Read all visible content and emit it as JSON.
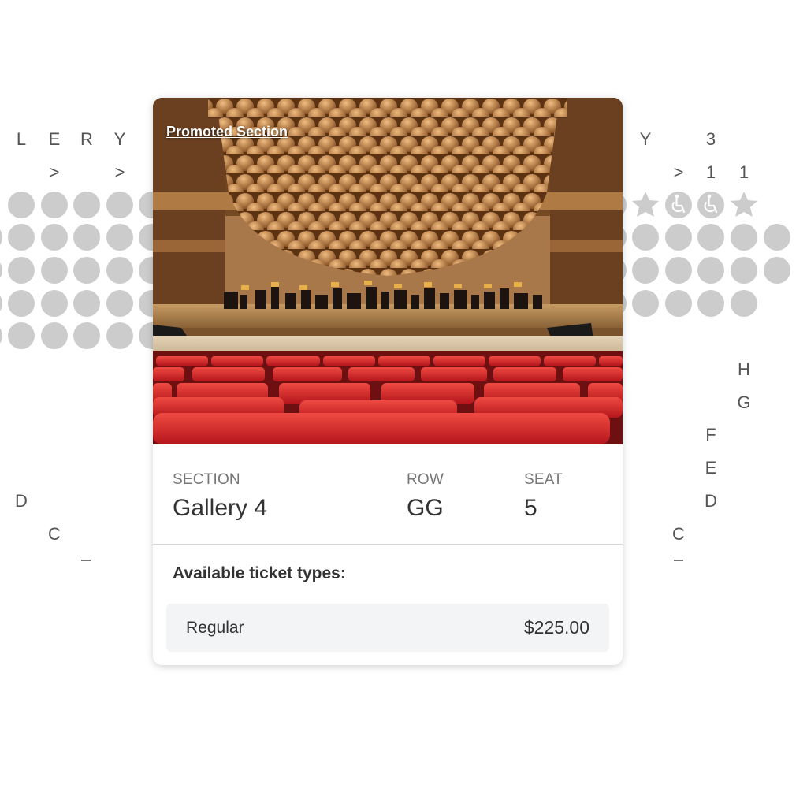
{
  "seatmap": {
    "left_header": [
      "L",
      "E",
      "R",
      "Y"
    ],
    "left_arrows": [
      ">",
      ">"
    ],
    "right_header": [
      "Y",
      "3"
    ],
    "right_subheader": [
      ">",
      "1",
      "1"
    ],
    "right_row_letters": [
      "H",
      "G",
      "F",
      "E",
      "D",
      "C"
    ],
    "left_row_letters": [
      "D",
      "C"
    ],
    "icons": [
      "star-icon",
      "wheelchair-icon",
      "wheelchair-icon",
      "star-icon"
    ],
    "seat_color": "#cccccc"
  },
  "card": {
    "promo_link": "Promoted Section",
    "section_label": "SECTION",
    "section_value": "Gallery 4",
    "row_label": "ROW",
    "row_value": "GG",
    "seat_label": "SEAT",
    "seat_value": "5",
    "tickets_title": "Available ticket types:",
    "tickets": [
      {
        "name": "Regular",
        "price": "$225.00"
      }
    ]
  },
  "colors": {
    "seat_red": "#d6262c",
    "panel_bg": "#f3f4f6",
    "text": "#333333",
    "muted": "#777777"
  }
}
